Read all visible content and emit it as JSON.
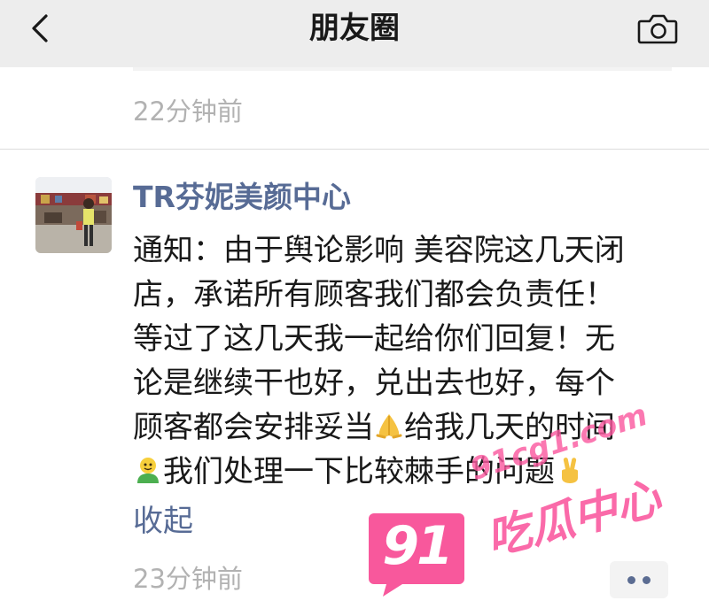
{
  "header": {
    "title": "朋友圈",
    "back_icon": "chevron-left-icon",
    "camera_icon": "camera-icon"
  },
  "previous_post": {
    "time": "22分钟前"
  },
  "post": {
    "author": "TR芬妮美颜中心",
    "avatar_icon": "avatar-photo",
    "lines": [
      "通知：由于舆论影响 美容院这几天闭",
      "店，承诺所有顾客我们都会负责任！",
      "等过了这几天我一起给你们回复！无",
      "论是继续干也好，兑出去也好，每个"
    ],
    "line5": {
      "before": "顾客都会安排妥当",
      "emoji": "pray-emoji",
      "after": "给我几天的时间"
    },
    "line6": {
      "emoji": "person-emoji",
      "text": "我们处理一下比较棘手的问题",
      "end_emoji": "victory-hand-emoji"
    },
    "collapse_label": "收起",
    "time": "23分钟前",
    "more_icon": "more-dots-icon"
  },
  "watermark": {
    "badge": "91",
    "url": "91cg1.com",
    "slogan": "吃瓜中心"
  },
  "colors": {
    "link": "#576b95",
    "muted": "#b2b2b2",
    "header_bg": "#ededed",
    "watermark_pink": "#f8589c"
  }
}
